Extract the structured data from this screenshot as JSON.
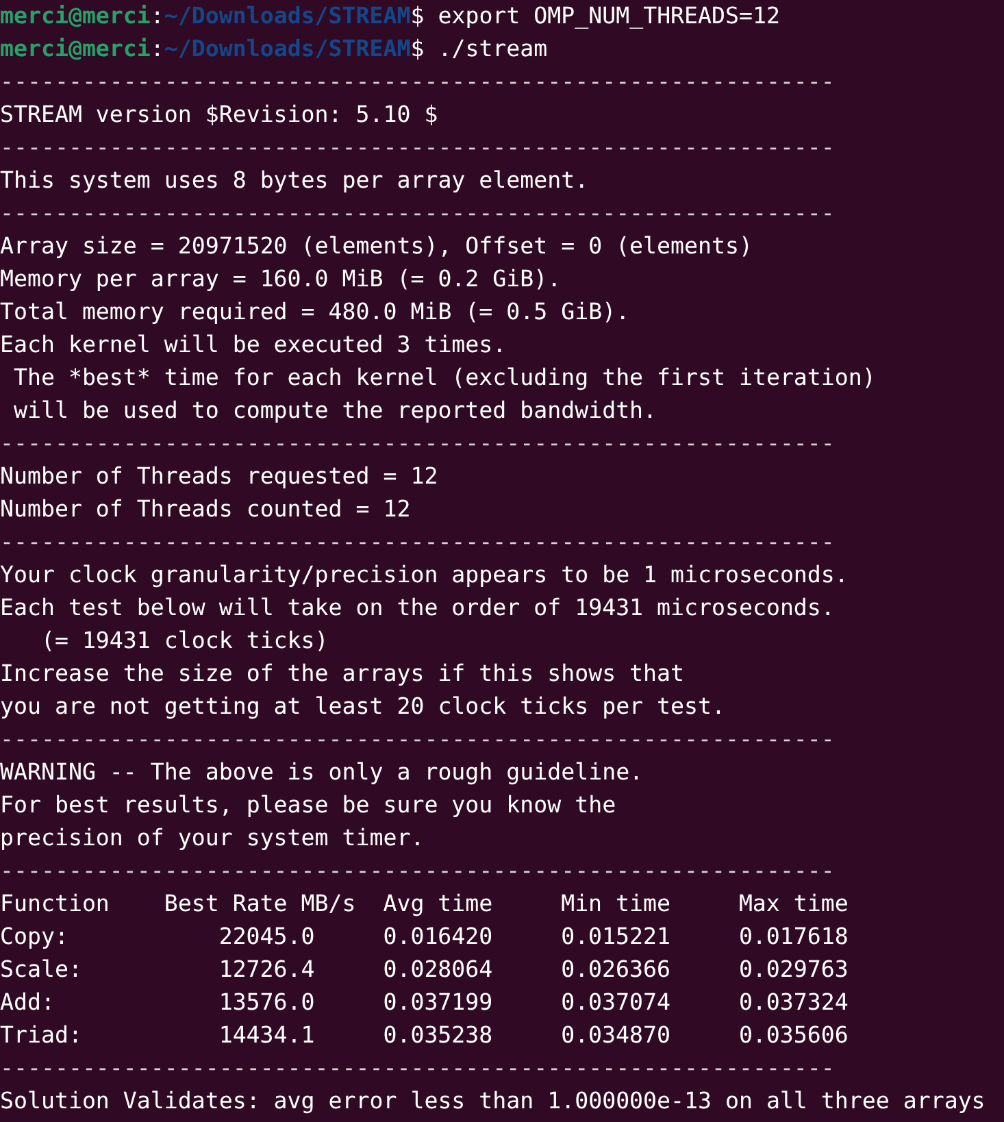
{
  "terminal_lines": [
    {
      "kind": "prompt",
      "user": "merci@merci",
      "colon": ":",
      "path": "~/Downloads/STREAM",
      "symbol": "$",
      "command": "export OMP_NUM_THREADS=12"
    },
    {
      "kind": "prompt",
      "user": "merci@merci",
      "colon": ":",
      "path": "~/Downloads/STREAM",
      "symbol": "$",
      "command": "./stream"
    },
    {
      "kind": "separator",
      "text": "-------------------------------------------------------------"
    },
    {
      "kind": "text",
      "text": "STREAM version $Revision: 5.10 $"
    },
    {
      "kind": "separator",
      "text": "-------------------------------------------------------------"
    },
    {
      "kind": "text",
      "text": "This system uses 8 bytes per array element."
    },
    {
      "kind": "separator",
      "text": "-------------------------------------------------------------"
    },
    {
      "kind": "text",
      "text": "Array size = 20971520 (elements), Offset = 0 (elements)"
    },
    {
      "kind": "text",
      "text": "Memory per array = 160.0 MiB (= 0.2 GiB)."
    },
    {
      "kind": "text",
      "text": "Total memory required = 480.0 MiB (= 0.5 GiB)."
    },
    {
      "kind": "text",
      "text": "Each kernel will be executed 3 times."
    },
    {
      "kind": "text",
      "text": " The *best* time for each kernel (excluding the first iteration)"
    },
    {
      "kind": "text",
      "text": " will be used to compute the reported bandwidth."
    },
    {
      "kind": "separator",
      "text": "-------------------------------------------------------------"
    },
    {
      "kind": "text",
      "text": "Number of Threads requested = 12"
    },
    {
      "kind": "text",
      "text": "Number of Threads counted = 12"
    },
    {
      "kind": "separator",
      "text": "-------------------------------------------------------------"
    },
    {
      "kind": "text",
      "text": "Your clock granularity/precision appears to be 1 microseconds."
    },
    {
      "kind": "text",
      "text": "Each test below will take on the order of 19431 microseconds."
    },
    {
      "kind": "text",
      "text": "   (= 19431 clock ticks)"
    },
    {
      "kind": "text",
      "text": "Increase the size of the arrays if this shows that"
    },
    {
      "kind": "text",
      "text": "you are not getting at least 20 clock ticks per test."
    },
    {
      "kind": "separator",
      "text": "-------------------------------------------------------------"
    },
    {
      "kind": "text",
      "text": "WARNING -- The above is only a rough guideline."
    },
    {
      "kind": "text",
      "text": "For best results, please be sure you know the"
    },
    {
      "kind": "text",
      "text": "precision of your system timer."
    },
    {
      "kind": "separator",
      "text": "-------------------------------------------------------------"
    },
    {
      "kind": "table",
      "columns": [
        "Function",
        "Best Rate MB/s",
        "Avg time",
        "Min time",
        "Max time"
      ],
      "rows": [
        [
          "Copy:",
          "22045.0",
          "0.016420",
          "0.015221",
          "0.017618"
        ],
        [
          "Scale:",
          "12726.4",
          "0.028064",
          "0.026366",
          "0.029763"
        ],
        [
          "Add:",
          "13576.0",
          "0.037199",
          "0.037074",
          "0.037324"
        ],
        [
          "Triad:",
          "14434.1",
          "0.035238",
          "0.034870",
          "0.035606"
        ]
      ]
    },
    {
      "kind": "separator",
      "text": "-------------------------------------------------------------"
    },
    {
      "kind": "text",
      "text": "Solution Validates: avg error less than 1.000000e-13 on all three arrays"
    }
  ]
}
